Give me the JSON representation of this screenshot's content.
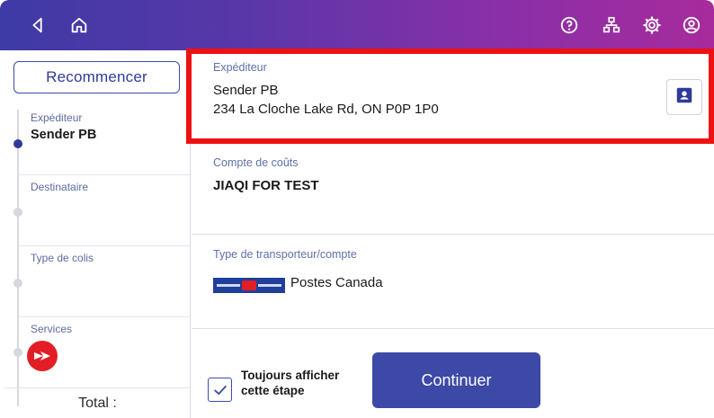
{
  "colors": {
    "accent": "#3d49a6",
    "highlight": "#ee1111",
    "topbar_start": "#3e3aa6",
    "topbar_end": "#a72b9c",
    "label_text": "#6070a8"
  },
  "topbar": {
    "left_icons": [
      "back-icon",
      "home-icon"
    ],
    "right_icons": [
      "help-icon",
      "network-icon",
      "settings-icon",
      "account-icon"
    ]
  },
  "sidebar": {
    "restart_label": "Recommencer",
    "steps": [
      {
        "label": "Expéditeur",
        "value": "Sender PB",
        "active": true
      },
      {
        "label": "Destinataire",
        "value": "",
        "active": false
      },
      {
        "label": "Type de colis",
        "value": "",
        "active": false
      },
      {
        "label": "Services",
        "icon": "canada-post-icon",
        "active": false
      }
    ],
    "total_label": "Total :"
  },
  "main": {
    "sender": {
      "label": "Expéditeur",
      "name": "Sender PB",
      "address": "234 La Cloche Lake Rd, ON P0P 1P0",
      "contact_icon": "contact-card-icon"
    },
    "cost_account": {
      "label": "Compte de coûts",
      "value": "JIAQI FOR TEST"
    },
    "carrier": {
      "label": "Type de transporteur/compte",
      "value": "Postes Canada",
      "logo": "canada-post-logo"
    },
    "footer": {
      "checkbox_checked": true,
      "checkbox_label_line1": "Toujours afficher",
      "checkbox_label_line2": "cette étape",
      "continue_label": "Continuer"
    }
  }
}
